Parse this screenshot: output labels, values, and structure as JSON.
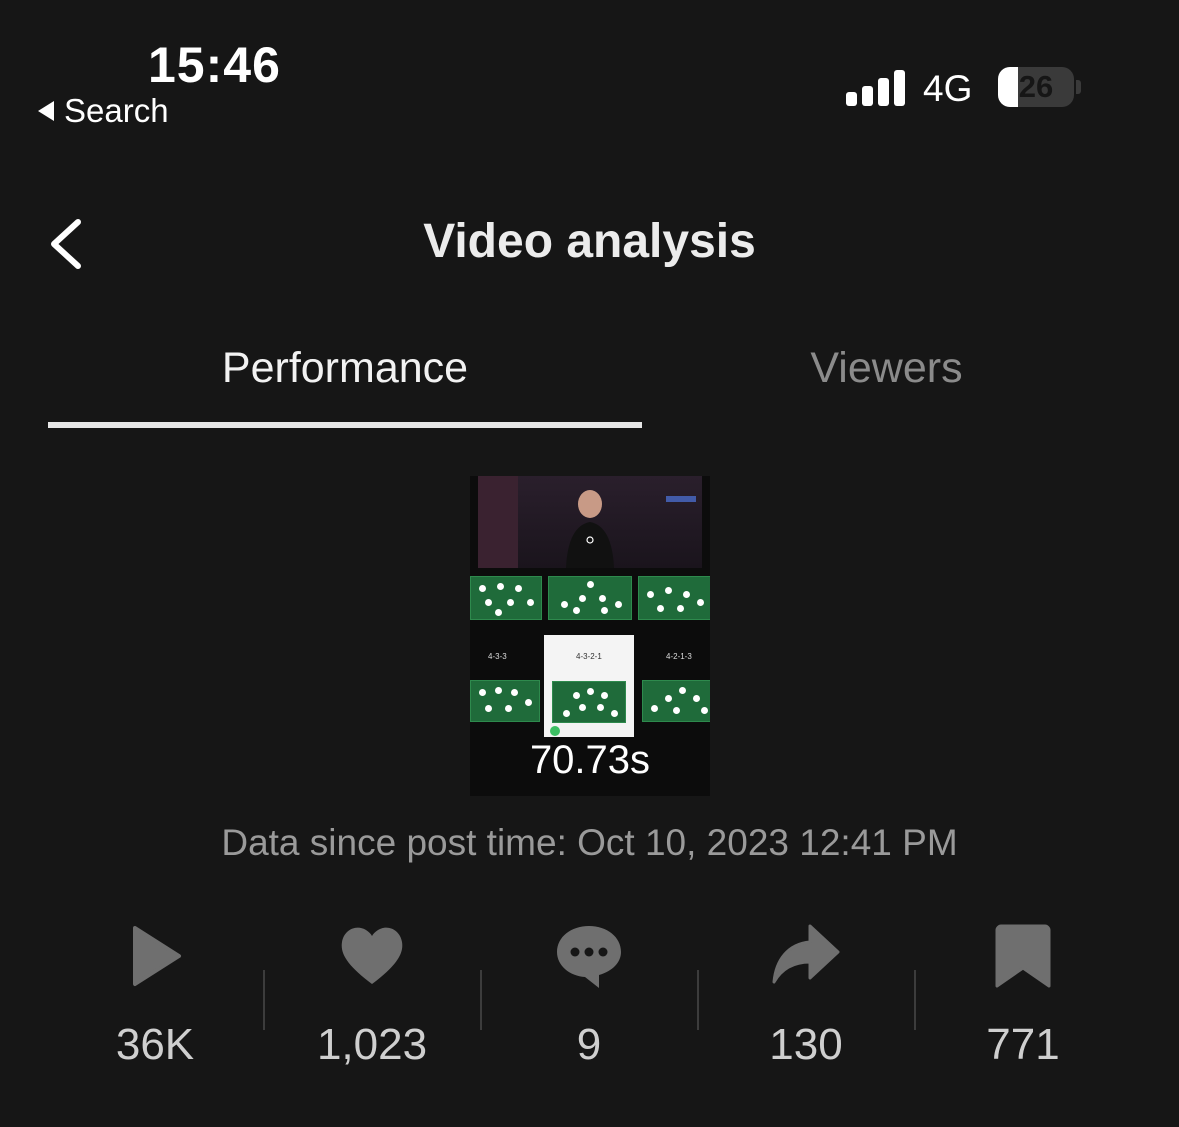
{
  "status_bar": {
    "time": "15:46",
    "back_app": "Search",
    "network": "4G",
    "battery": "26",
    "battery_level": 0.26,
    "signal_bars": 4
  },
  "header": {
    "title": "Video analysis"
  },
  "tabs": [
    {
      "label": "Performance",
      "active": true
    },
    {
      "label": "Viewers",
      "active": false
    }
  ],
  "video": {
    "duration": "70.73s",
    "formations": [
      "4-3-3",
      "4-3-2-1",
      "4-2-1-3"
    ]
  },
  "post_time": "Data since post time: Oct 10, 2023 12:41 PM",
  "stats": [
    {
      "icon": "play-icon",
      "value": "36K"
    },
    {
      "icon": "heart-icon",
      "value": "1,023"
    },
    {
      "icon": "comment-icon",
      "value": "9"
    },
    {
      "icon": "share-icon",
      "value": "130"
    },
    {
      "icon": "bookmark-icon",
      "value": "771"
    }
  ],
  "colors": {
    "background": "#161616",
    "icon_gray": "#6f6f6f",
    "inactive_tab": "#8b8b8b",
    "pitch_green": "#1f6b3a"
  }
}
